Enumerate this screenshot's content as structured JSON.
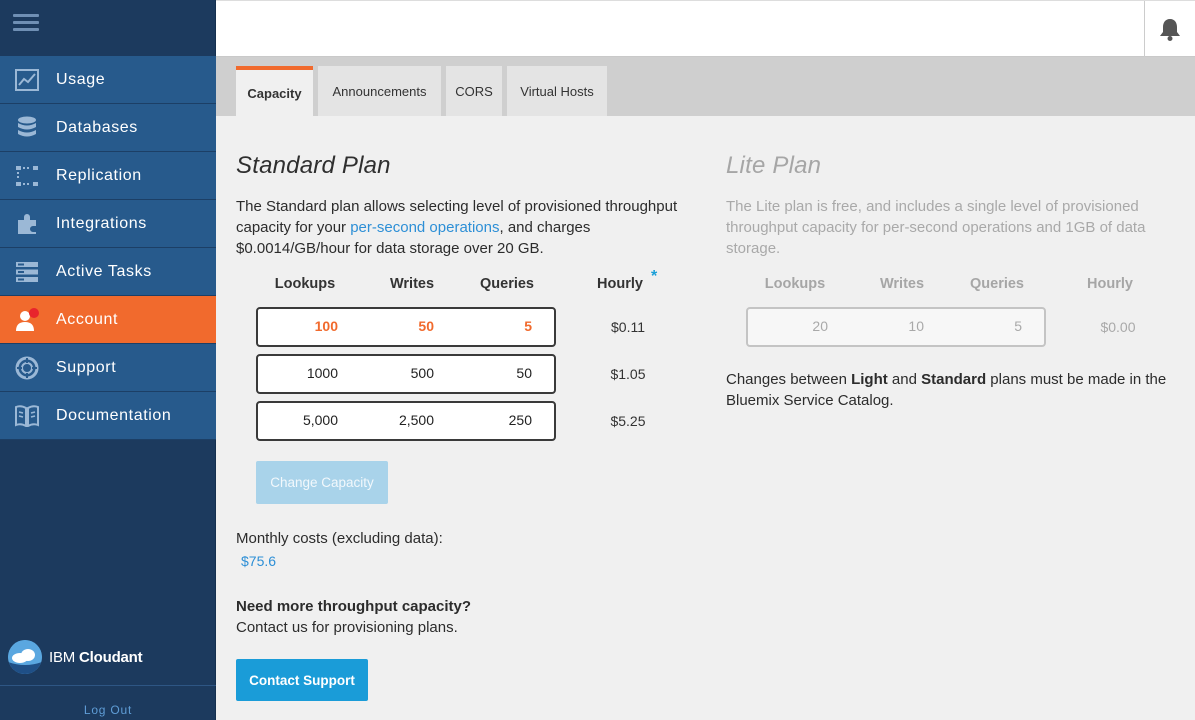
{
  "sidebar": {
    "items": [
      {
        "label": "Usage",
        "icon": "chart-line-icon"
      },
      {
        "label": "Databases",
        "icon": "database-icon"
      },
      {
        "label": "Replication",
        "icon": "replication-icon"
      },
      {
        "label": "Integrations",
        "icon": "puzzle-piece-icon"
      },
      {
        "label": "Active Tasks",
        "icon": "tasks-list-icon"
      },
      {
        "label": "Account",
        "icon": "user-account-icon"
      },
      {
        "label": "Support",
        "icon": "lifebuoy-icon"
      },
      {
        "label": "Documentation",
        "icon": "book-icon"
      }
    ],
    "active_item": "Account",
    "logo_prefix": "IBM",
    "logo_brand": "Cloudant",
    "logout_label": "Log Out"
  },
  "header": {
    "notification_icon": "bell-icon"
  },
  "tabs": [
    {
      "label": "Capacity",
      "active": true
    },
    {
      "label": "Announcements",
      "active": false
    },
    {
      "label": "CORS",
      "active": false
    },
    {
      "label": "Virtual Hosts",
      "active": false
    }
  ],
  "standard_plan": {
    "title": "Standard Plan",
    "desc_before_link": "The Standard plan allows selecting level of provisioned throughput capacity for your ",
    "desc_link": "per-second operations",
    "desc_after_link": ", and charges $0.0014/GB/hour for data storage over 20 GB.",
    "columns": [
      "Lookups",
      "Writes",
      "Queries",
      "Hourly"
    ],
    "hourly_marker": "*",
    "options": [
      {
        "lookups": "100",
        "writes": "50",
        "queries": "5",
        "hourly": "$0.11",
        "selected": true
      },
      {
        "lookups": "1000",
        "writes": "500",
        "queries": "50",
        "hourly": "$1.05",
        "selected": false
      },
      {
        "lookups": "5,000",
        "writes": "2,500",
        "queries": "250",
        "hourly": "$5.25",
        "selected": false
      }
    ],
    "change_button": "Change Capacity",
    "monthly_label": "Monthly costs (excluding data):",
    "monthly_value": "$75.6",
    "more_heading": "Need more throughput capacity?",
    "more_text": "Contact us for provisioning plans.",
    "contact_button": "Contact Support"
  },
  "lite_plan": {
    "title": "Lite Plan",
    "desc": "The Lite plan is free, and includes a single level of provisioned throughput capacity for per-second operations and 1GB of data storage.",
    "columns": [
      "Lookups",
      "Writes",
      "Queries",
      "Hourly"
    ],
    "option": {
      "lookups": "20",
      "writes": "10",
      "queries": "5",
      "hourly": "$0.00"
    },
    "note_part1": "Changes between ",
    "note_light": "Light",
    "note_part2": " and ",
    "note_standard": "Standard",
    "note_part3": " plans must be made in the Bluemix Service Catalog."
  },
  "colors": {
    "sidebar_bg": "#1c3a5e",
    "nav_item_bg": "#275a8c",
    "accent_orange": "#f16a2d",
    "link_blue": "#2d8fd6",
    "button_blue": "#1a9cd8"
  }
}
